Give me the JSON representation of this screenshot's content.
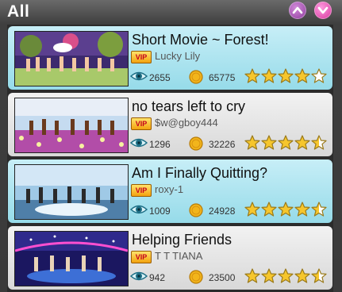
{
  "header": {
    "title": "All"
  },
  "colors": {
    "row_odd": "#b0e6f0",
    "row_even": "#e6e6e6",
    "star_fill": "#f6c62d"
  },
  "icons": {
    "scroll_up": "chevron-up-icon",
    "scroll_down": "chevron-down-icon",
    "views": "eye-icon",
    "coins": "coin-icon",
    "vip": "vip-badge-icon"
  },
  "movies": [
    {
      "title": "Short Movie ~ Forest!",
      "vip_label": "VIP",
      "author": "Lucky Lily",
      "views": "2655",
      "coins": "65775",
      "rating": 4,
      "theme": "forest"
    },
    {
      "title": "no tears left to cry",
      "vip_label": "VIP",
      "author": "$w@gboy444",
      "views": "1296",
      "coins": "32226",
      "rating": 4.5,
      "theme": "flowers"
    },
    {
      "title": "Am I Finally Quitting?",
      "vip_label": "VIP",
      "author": "roxy-1",
      "views": "1009",
      "coins": "24928",
      "rating": 4.5,
      "theme": "stage"
    },
    {
      "title": "Helping Friends",
      "vip_label": "VIP",
      "author": "T T TIANA",
      "views": "942",
      "coins": "23500",
      "rating": 4.5,
      "theme": "club"
    }
  ]
}
